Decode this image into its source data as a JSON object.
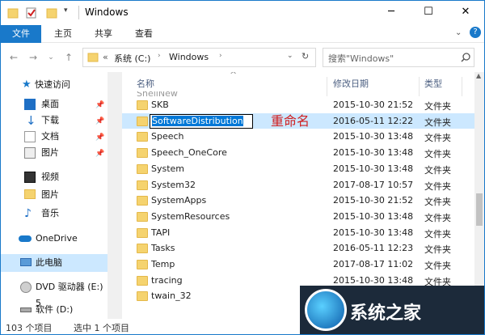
{
  "window": {
    "title": "Windows",
    "minimize": "─",
    "maximize": "☐",
    "close": "✕",
    "help": "?"
  },
  "ribbon": {
    "tabs": [
      "文件",
      "主页",
      "共享",
      "查看"
    ]
  },
  "address": {
    "prefix": "«",
    "crumbs": [
      "系统 (C:)",
      "Windows"
    ],
    "search_placeholder": "搜索\"Windows\""
  },
  "nav": {
    "quick_access": "快速访问",
    "items": [
      {
        "label": "桌面",
        "icon": "desktop-icon",
        "pinned": true
      },
      {
        "label": "下载",
        "icon": "download-icon",
        "pinned": true
      },
      {
        "label": "文档",
        "icon": "document-icon",
        "pinned": true
      },
      {
        "label": "图片",
        "icon": "picture-icon",
        "pinned": true
      },
      {
        "label": "视频",
        "icon": "video-icon",
        "pinned": false
      },
      {
        "label": "图片",
        "icon": "folder-icon",
        "pinned": false
      },
      {
        "label": "音乐",
        "icon": "music-icon",
        "pinned": false
      }
    ],
    "onedrive": "OneDrive",
    "this_pc": "此电脑",
    "dvd": "DVD 驱动器 (E:) 5",
    "drive_d": "软件 (D:)"
  },
  "columns": {
    "name": "名称",
    "date": "修改日期",
    "type": "类型"
  },
  "files": [
    {
      "name": "SKB",
      "date": "2015-10-30 21:52",
      "type": "文件夹"
    },
    {
      "name": "SoftwareDistribution",
      "date": "2016-05-11 12:22",
      "type": "文件夹"
    },
    {
      "name": "Speech",
      "date": "2015-10-30 13:48",
      "type": "文件夹"
    },
    {
      "name": "Speech_OneCore",
      "date": "2015-10-30 13:48",
      "type": "文件夹"
    },
    {
      "name": "System",
      "date": "2015-10-30 13:48",
      "type": "文件夹"
    },
    {
      "name": "System32",
      "date": "2017-08-17 10:57",
      "type": "文件夹"
    },
    {
      "name": "SystemApps",
      "date": "2015-10-30 21:52",
      "type": "文件夹"
    },
    {
      "name": "SystemResources",
      "date": "2015-10-30 13:48",
      "type": "文件夹"
    },
    {
      "name": "TAPI",
      "date": "2015-10-30 13:48",
      "type": "文件夹"
    },
    {
      "name": "Tasks",
      "date": "2016-05-11 12:23",
      "type": "文件夹"
    },
    {
      "name": "Temp",
      "date": "2017-08-17 11:02",
      "type": "文件夹"
    },
    {
      "name": "tracing",
      "date": "2015-10-30 13:48",
      "type": "文件夹"
    },
    {
      "name": "twain_32",
      "date": "2015-10-30 13:48",
      "type": "文件夹"
    }
  ],
  "rename": {
    "value": "SoftwareDistribution",
    "annotation": "重命名"
  },
  "status": {
    "count": "103 个项目",
    "selected": "选中 1 个项目"
  },
  "watermark": {
    "text": "系统之家"
  },
  "colors": {
    "accent": "#1979ca",
    "selection": "#cce8ff",
    "annotation": "#d02020"
  }
}
